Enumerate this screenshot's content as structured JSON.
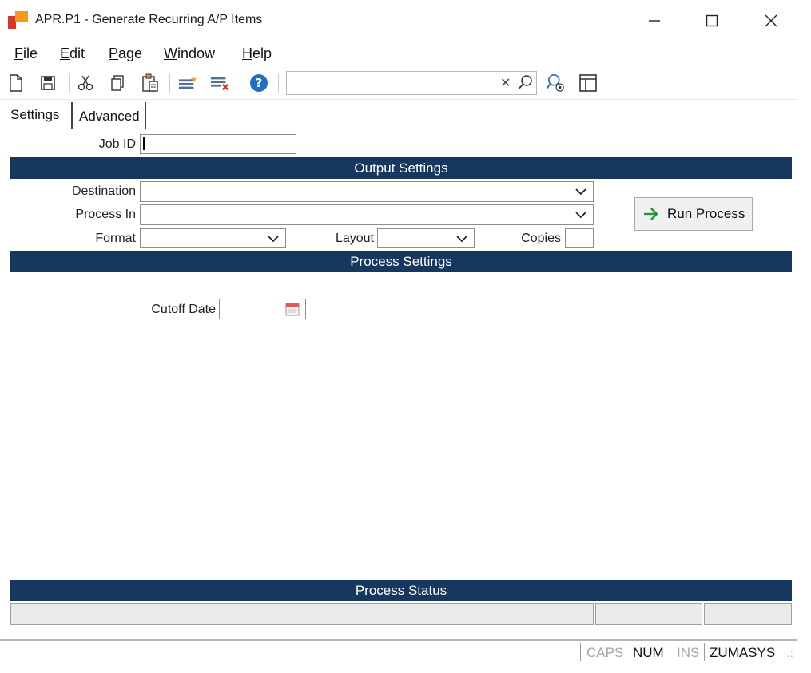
{
  "window": {
    "title": "APR.P1 - Generate Recurring A/P Items",
    "minimize_glyph": "—",
    "maximize_glyph": "☐",
    "close_glyph": "✕"
  },
  "menu": {
    "file_key": "F",
    "file_rest": "ile",
    "edit_key": "E",
    "edit_rest": "dit",
    "page_key": "P",
    "page_rest": "age",
    "window_key": "W",
    "window_rest": "indow",
    "help_key": "H",
    "help_rest": "elp"
  },
  "toolbar": {
    "icons": [
      "new-page-icon",
      "save-icon",
      "cut-icon",
      "copy-icon",
      "paste-icon",
      "insert-row-icon",
      "delete-row-icon",
      "help-icon",
      "lookup-icon",
      "layout-icon"
    ],
    "search_value": "",
    "search_clear_glyph": "✕"
  },
  "tabs": {
    "settings": "Settings",
    "advanced": "Advanced"
  },
  "form": {
    "job_id_label": "Job ID",
    "job_id_value": "",
    "output_settings_header": "Output Settings",
    "destination_label": "Destination",
    "destination_value": "",
    "process_in_label": "Process In",
    "process_in_value": "",
    "format_label": "Format",
    "format_value": "",
    "layout_label": "Layout",
    "layout_value": "",
    "copies_label": "Copies",
    "copies_value": "",
    "run_process_label": "Run Process",
    "process_settings_header": "Process Settings",
    "cutoff_date_label": "Cutoff Date",
    "cutoff_date_value": "",
    "process_status_header": "Process Status"
  },
  "statusbar": {
    "caps": "CAPS",
    "num": "NUM",
    "ins": "INS",
    "user": "ZUMASYS",
    "grip": ".:"
  },
  "colors": {
    "section_header_bg": "#16375e",
    "section_header_text": "#ffffff",
    "logo_red": "#d9362b",
    "logo_orange": "#f39a1d",
    "help_blue": "#1f6fc5",
    "run_arrow_green": "#1a9a2e",
    "delete_x_red": "#d32f2f"
  }
}
